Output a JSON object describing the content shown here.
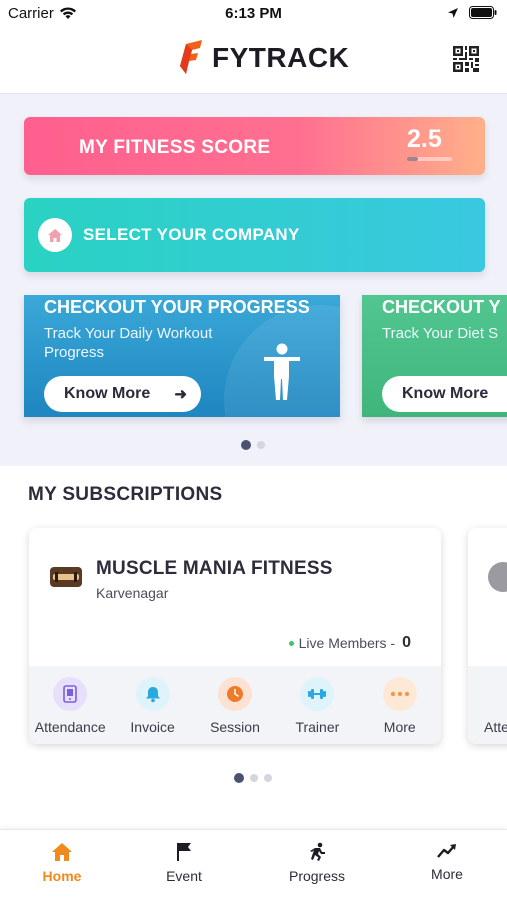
{
  "status_bar": {
    "carrier": "Carrier",
    "time": "6:13 PM"
  },
  "header": {
    "app_name": "FYTRACK"
  },
  "fitness_score": {
    "label": "MY FITNESS SCORE",
    "value": "2.5",
    "progress": 0.25
  },
  "company": {
    "label": "SELECT YOUR COMPANY"
  },
  "promos": [
    {
      "title": "CHECKOUT YOUR PROGRESS",
      "subtitle": "Track Your Daily Workout Progress",
      "button": "Know More"
    },
    {
      "title": "CHECKOUT Y",
      "subtitle": "Track Your Diet S",
      "button": "Know More"
    }
  ],
  "subscriptions": {
    "title": "MY SUBSCRIPTIONS",
    "cards": [
      {
        "name": "MUSCLE MANIA FITNESS",
        "location": "Karvenagar",
        "live_label": "Live Members - ",
        "live_count": "0",
        "actions": [
          {
            "label": "Attendance",
            "icon": "phone-icon",
            "color": "#e8e0fb"
          },
          {
            "label": "Invoice",
            "icon": "bell-icon",
            "color": "#dff3fb"
          },
          {
            "label": "Session",
            "icon": "clock-icon",
            "color": "#fde2d4"
          },
          {
            "label": "Trainer",
            "icon": "dumbbell-icon",
            "color": "#dff3fb"
          },
          {
            "label": "More",
            "icon": "more-dots-icon",
            "color": "#fde9d6"
          }
        ]
      },
      {
        "peek_label": "Atte"
      }
    ]
  },
  "bottom_nav": [
    {
      "label": "Home",
      "icon": "home-icon",
      "active": true
    },
    {
      "label": "Event",
      "icon": "flag-icon",
      "active": false
    },
    {
      "label": "Progress",
      "icon": "running-icon",
      "active": false
    },
    {
      "label": "More",
      "icon": "trend-up-icon",
      "active": false
    }
  ],
  "colors": {
    "accent": "#f08a1a",
    "score_gradient_start": "#ff5f8f",
    "company_gradient_start": "#2ad2c2"
  }
}
